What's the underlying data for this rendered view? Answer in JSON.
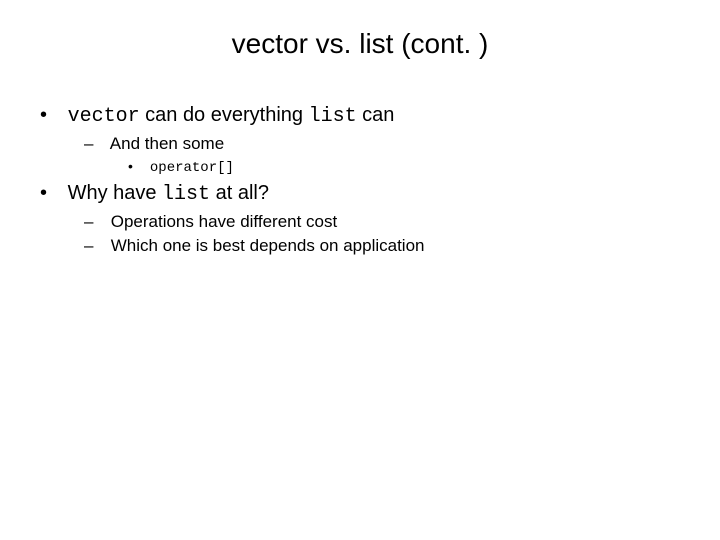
{
  "title": "vector vs. list (cont. )",
  "bullets": {
    "b1": {
      "code1": "vector",
      "mid": " can do everything ",
      "code2": "list",
      "tail": " can"
    },
    "b1_1": "And then some",
    "b1_1_1": "operator[]",
    "b2": {
      "pre": "Why have ",
      "code": "list",
      "post": " at all?"
    },
    "b2_1": "Operations have different cost",
    "b2_2": "Which one is best depends on application"
  }
}
